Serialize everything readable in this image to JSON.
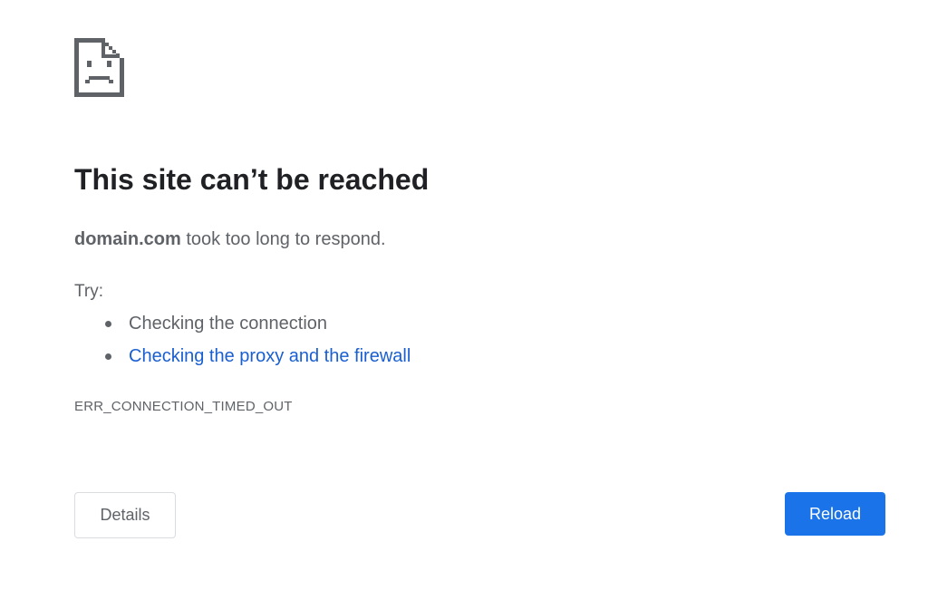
{
  "error_page": {
    "icon": "sad-document-icon",
    "heading": "This site can’t be reached",
    "summary": {
      "domain": "domain.com",
      "message": " took too long to respond."
    },
    "try_label": "Try:",
    "suggestions": [
      {
        "text": "Checking the connection",
        "is_link": false
      },
      {
        "text": "Checking the proxy and the firewall",
        "is_link": true
      }
    ],
    "error_code": "ERR_CONNECTION_TIMED_OUT"
  },
  "buttons": {
    "details_label": "Details",
    "reload_label": "Reload"
  },
  "colors": {
    "heading": "#202124",
    "body_text": "#5f6368",
    "link": "#1a5fd0",
    "primary_button": "#1a73e8",
    "button_border": "#dadce0"
  }
}
